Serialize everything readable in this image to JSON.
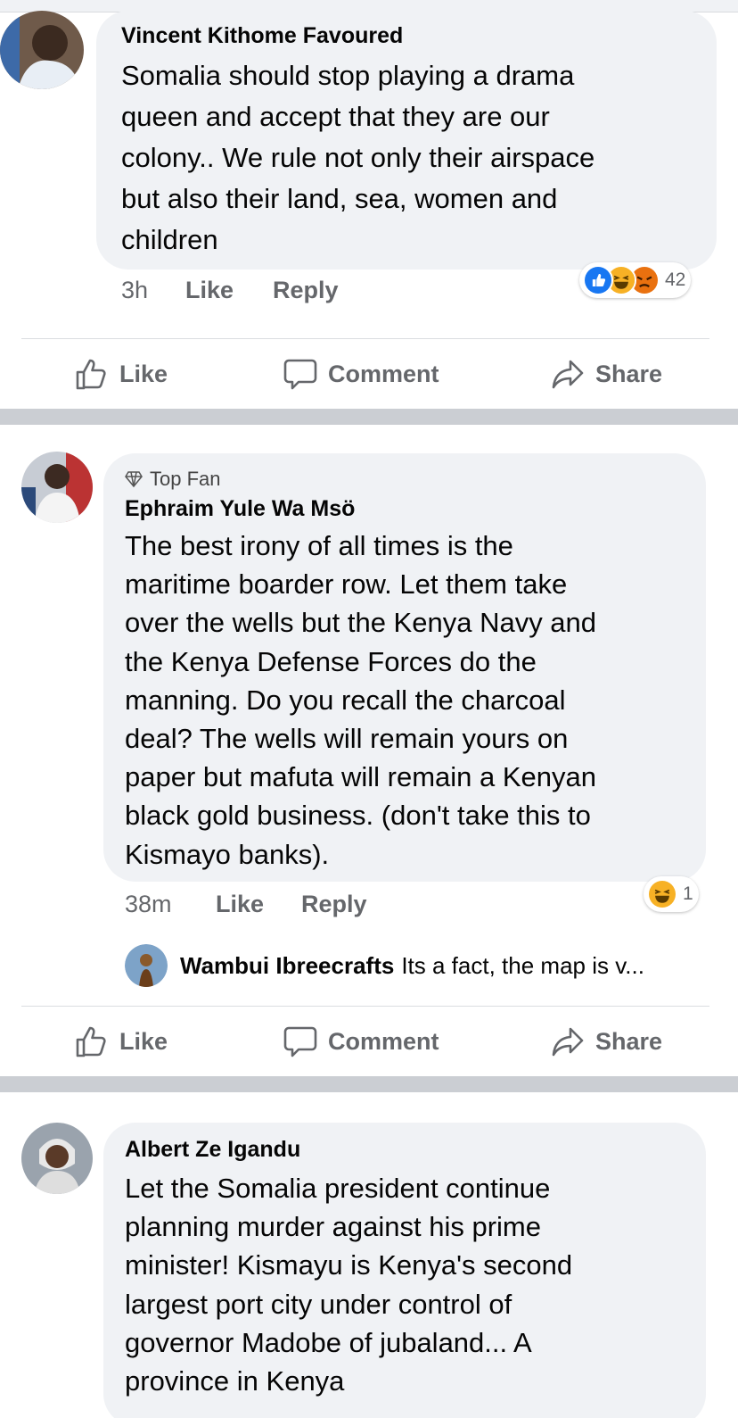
{
  "comments": [
    {
      "author": "Vincent Kithome Favoured",
      "text": "Somalia should stop playing a drama\nqueen and accept that they are our\ncolony.. We rule not only their airspace\nbut also their land, sea, women and\nchildren",
      "time": "3h",
      "like_label": "Like",
      "reply_label": "Reply",
      "reaction_count": "42",
      "reactions": [
        "like",
        "haha",
        "angry"
      ]
    },
    {
      "badge": "Top Fan",
      "author": "Ephraim Yule Wa Msö",
      "text": "The best irony of all times is the\nmaritime boarder row. Let them take\nover the wells but the Kenya Navy and\nthe Kenya Defense Forces do the\nmanning. Do you recall the charcoal\ndeal? The wells will remain yours on\npaper but mafuta will remain a Kenyan\nblack gold business. (don't take this to\nKismayo banks).",
      "time": "38m",
      "like_label": "Like",
      "reply_label": "Reply",
      "reaction_count": "1",
      "reactions": [
        "haha"
      ],
      "reply_preview": {
        "author": "Wambui Ibreecrafts",
        "text": "Its a fact, the map is v..."
      }
    },
    {
      "author": "Albert Ze Igandu",
      "text": "Let the Somalia president continue\nplanning murder against his prime\nminister! Kismayu is Kenya's second\nlargest port city under control of\ngovernor Madobe of jubaland... A\nprovince in Kenya"
    }
  ],
  "actions": {
    "like": "Like",
    "comment": "Comment",
    "share": "Share"
  },
  "colors": {
    "bubble": "#f0f2f5",
    "meta": "#65676b",
    "separator": "#cbced3",
    "like_blue": "#1877f2",
    "haha_yellow": "#f7b125",
    "angry_orange": "#e9710f"
  }
}
